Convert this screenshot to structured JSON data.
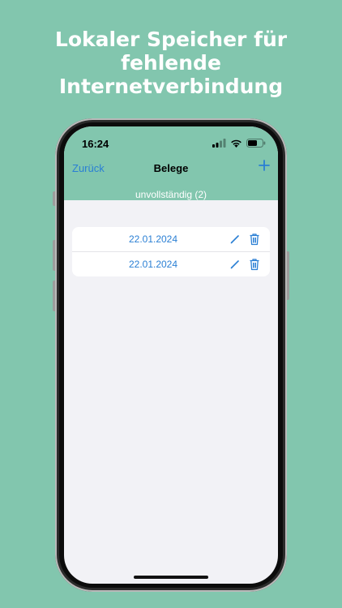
{
  "promo": {
    "headline_lines": [
      "Lokaler Speicher für",
      "fehlende",
      "Internetverbindung"
    ]
  },
  "status_bar": {
    "time": "16:24",
    "icons": [
      "cellular-signal-icon",
      "wifi-icon",
      "battery-icon"
    ]
  },
  "nav": {
    "back_label": "Zurück",
    "title": "Belege",
    "add_icon": "plus-icon"
  },
  "segment": {
    "label": "unvollständig (2)"
  },
  "receipts": [
    {
      "date": "22.01.2024"
    },
    {
      "date": "22.01.2024"
    }
  ],
  "colors": {
    "background": "#82c6ae",
    "header": "#82c6ae",
    "link": "#2a7fd4",
    "screen_bg": "#f2f2f6"
  }
}
